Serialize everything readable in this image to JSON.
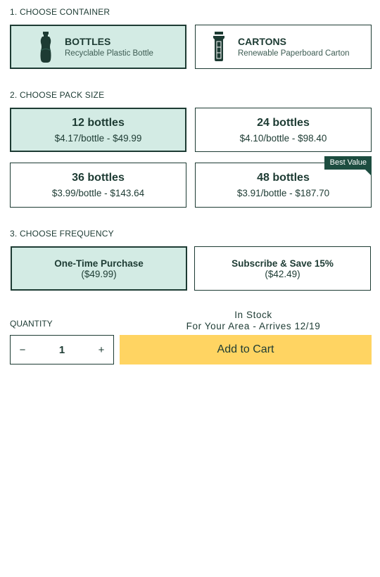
{
  "container": {
    "heading": "1. CHOOSE CONTAINER",
    "options": [
      {
        "title": "BOTTLES",
        "subtitle": "Recyclable Plastic Bottle",
        "icon": "bottle-icon"
      },
      {
        "title": "CARTONS",
        "subtitle": "Renewable Paperboard Carton",
        "icon": "carton-icon"
      }
    ],
    "selected": "BOTTLES"
  },
  "pack": {
    "heading": "2. CHOOSE PACK SIZE",
    "options": [
      {
        "title": "12 bottles",
        "price": "$4.17/bottle - $49.99"
      },
      {
        "title": "24 bottles",
        "price": "$4.10/bottle - $98.40"
      },
      {
        "title": "36 bottles",
        "price": "$3.99/bottle - $143.64"
      },
      {
        "title": "48 bottles",
        "price": "$3.91/bottle - $187.70",
        "badge": "Best Value"
      }
    ],
    "selected": "12 bottles"
  },
  "frequency": {
    "heading": "3. CHOOSE FREQUENCY",
    "options": [
      {
        "title": "One-Time Purchase",
        "price": "($49.99)"
      },
      {
        "title": "Subscribe & Save 15%",
        "price": "($42.49)"
      }
    ],
    "selected": "One-Time Purchase"
  },
  "stock": {
    "line1": "In Stock",
    "line2": "For Your Area - Arrives 12/19"
  },
  "quantity": {
    "label": "QUANTITY",
    "value": "1",
    "minus": "−",
    "plus": "+"
  },
  "cart": {
    "label": "Add to Cart"
  },
  "colors": {
    "primary": "#1d3b33",
    "selected_bg": "#d3ebe4",
    "badge_bg": "#1d4d40",
    "cart_bg": "#ffd462"
  }
}
